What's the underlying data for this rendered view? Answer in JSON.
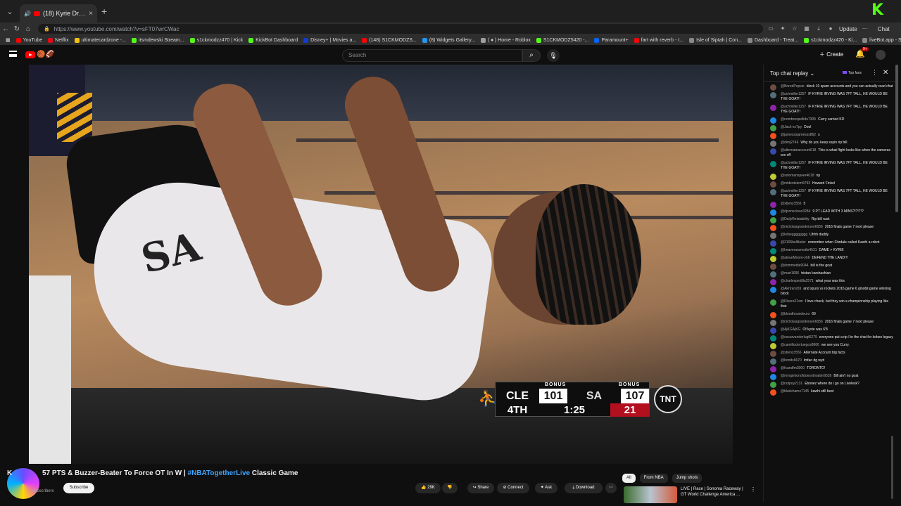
{
  "browser": {
    "tab_title": "(18) Kyrie Drops 57 PTS & Bu",
    "url": "https://www.youtube.com/watch?v=sFT07wrCWac",
    "update_label": "Update",
    "chat_label": "Chat",
    "bookmarks": [
      {
        "label": "YouTube",
        "color": "#ff0000"
      },
      {
        "label": "Netflix",
        "color": "#e50914"
      },
      {
        "label": "ultimatecardzone -...",
        "color": "#f4c20d"
      },
      {
        "label": "itsmdewski Stream...",
        "color": "#53fc18"
      },
      {
        "label": "s1ckmodzz470 | Kick",
        "color": "#53fc18"
      },
      {
        "label": "KickBot Dashboard",
        "color": "#53fc18"
      },
      {
        "label": "Disney+ | Movies a...",
        "color": "#113ccf"
      },
      {
        "label": "(148) S1CKMODZS...",
        "color": "#ff0000"
      },
      {
        "label": "(8) Widgets Gallery...",
        "color": "#2196f3"
      },
      {
        "label": "( ♦ ) Home - Roblox",
        "color": "#9e9e9e"
      },
      {
        "label": "S1CKMODZ5420 -...",
        "color": "#53fc18"
      },
      {
        "label": "Paramount+",
        "color": "#0064ff"
      },
      {
        "label": "fart with reverb - I...",
        "color": "#ff0000"
      },
      {
        "label": "Isle of Siptah | Con...",
        "color": "#888888"
      },
      {
        "label": "Dashboard - Treat...",
        "color": "#888888"
      },
      {
        "label": "s1ckmodzz420 - Ki...",
        "color": "#53fc18"
      },
      {
        "label": "liveBot.app - Strea...",
        "color": "#888888"
      }
    ],
    "other_favorites": "Other favorites"
  },
  "youtube": {
    "search_placeholder": "Search",
    "create_label": "Create",
    "notif_count": "9+"
  },
  "scorebug": {
    "bonus": "BONUS",
    "team1": "CLE",
    "score1": "101",
    "team2": "SA",
    "score2": "107",
    "quarter": "4TH",
    "clock": "1:25",
    "shot_clock": "21",
    "network": "TNT"
  },
  "video": {
    "title_prefix": "K",
    "title_main": "57 PTS & Buzzer-Beater To Force OT In W | ",
    "title_tag": "#NBATogetherLive",
    "title_suffix": " Classic Game",
    "subscribers": "subscribers",
    "subscribe": "Subscribe",
    "likes": "29K",
    "share": "Share",
    "connect": "Connect",
    "ask": "Ask",
    "download": "Download"
  },
  "recommendations": {
    "chips": [
      "All",
      "From NBA",
      "Jump shots"
    ],
    "rec_title": "LIVE | Race | Sonoma Raceway | GT World Challenge America ..."
  },
  "chat": {
    "header": "Top chat replay",
    "fans": "Top fans",
    "messages": [
      {
        "author": "@BoredPopsie",
        "text": "block 10 spam accounts and you can actually read chat"
      },
      {
        "author": "@achmiller1257",
        "text": "IF KYRIE IRVING WAS 7FT TALL, HE WOULD BE THE GOAT!!"
      },
      {
        "author": "@achmiller1257",
        "text": "IF KYRIE IRVING WAS 7FT TALL, HE WOULD BE THE GOAT!!"
      },
      {
        "author": "@nombrespellido7305",
        "text": "Curry carried KD"
      },
      {
        "author": "@Jack-xx7py",
        "text": "Dool"
      },
      {
        "author": "@jamesssjamesss862",
        "text": "s"
      },
      {
        "author": "@dimj2746",
        "text": "Why do you keep sayin rip bill"
      },
      {
        "author": "@alternateaccount618",
        "text": "This is what flight looks like when the cameras are off"
      },
      {
        "author": "@achmiller1257",
        "text": "IF KYRIE IRVING WAS 7FT TALL, HE WOULD BE THE GOAT!!"
      },
      {
        "author": "@solomanspeer4018",
        "text": "rip"
      },
      {
        "author": "@midentstem9793",
        "text": "Howard Finkel"
      },
      {
        "author": "@achmiller1257",
        "text": "IF KYRIE IRVING WAS 7FT TALL, HE WOULD BE THE GOAT!!"
      },
      {
        "author": "@xbenz3556",
        "text": "5"
      },
      {
        "author": "@djconscious3284",
        "text": "9 PT LEAD WITH 3 MINS?!?!?!?"
      },
      {
        "author": "@DailyRelatability",
        "text": "Rip bill rusk"
      },
      {
        "author": "@nicholasgrandersen6056",
        "text": "2016 finals game 7 next please"
      },
      {
        "author": "@kobegggggggg",
        "text": "Uhhh daddy"
      },
      {
        "author": "@2106bellikeler",
        "text": "remember when Fitzdale called Kawhi a robot"
      },
      {
        "author": "@heavenzamodio4531",
        "text": "DAME > KYRIE"
      },
      {
        "author": "@ateueMoore-yh6",
        "text": "DEFEND THE LAND!!!"
      },
      {
        "author": "@dommedia9044",
        "text": "bill is the goat"
      },
      {
        "author": "@mart1696",
        "text": "tristan karshashian"
      },
      {
        "author": "@charlespedilla2571",
        "text": "what year was this"
      },
      {
        "author": "@Akrtrans59",
        "text": "and spurs vs rockets 2016 game 6 ginobli game winning block"
      },
      {
        "author": "@Rivera21sm",
        "text": "I love chuck, but they win a championship playing like that"
      },
      {
        "author": "@bloodhoundeuro",
        "text": "69"
      },
      {
        "author": "@nicholasgrandersen6056",
        "text": "2016 finals game 7 next please"
      },
      {
        "author": "@AjKGAjKG",
        "text": "Of kyrie was 6'8"
      },
      {
        "author": "@oscarvanderlugt6279",
        "text": "everyone put a rip I in the chat for kobes legacy"
      },
      {
        "author": "@camillociertuegos8666",
        "text": "we see you Curry."
      },
      {
        "author": "@xbenz3556",
        "text": "Alternate Account big facts"
      },
      {
        "author": "@bonds6670",
        "text": "lmfao dg wyd"
      },
      {
        "author": "@fcandfm3000",
        "text": "TORONTO!"
      },
      {
        "author": "@myopinionofdoesntmatter9539",
        "text": "Bill ain't no goat"
      },
      {
        "author": "@notpoy2131",
        "text": "Ebonez where do i go on Livelesk?"
      },
      {
        "author": "@blackhams7145",
        "text": "kawhi still best"
      }
    ]
  }
}
